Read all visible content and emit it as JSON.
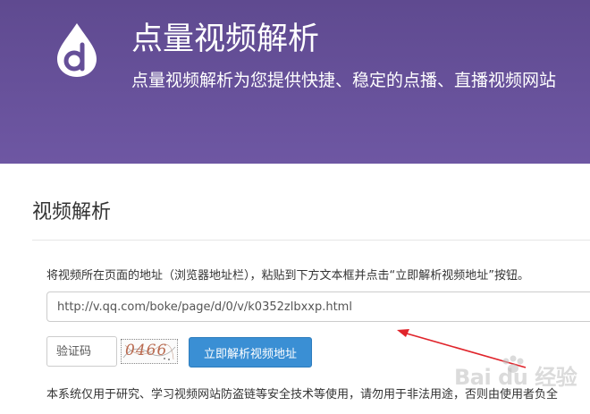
{
  "header": {
    "title": "点量视频解析",
    "subtitle": "点量视频解析为您提供快捷、稳定的点播、直播视频网站",
    "logo_icon": "droplet-d-logo-icon"
  },
  "panel": {
    "title": "视频解析",
    "instruction": "将视频所在页面的地址（浏览器地址栏），粘贴到下方文本框并点击“立即解析视频地址”按钮。",
    "url_value": "http://v.qq.com/boke/page/d/0/v/k0352zlbxxp.html",
    "captcha_placeholder": "验证码",
    "captcha_image_text": "0466",
    "parse_button_label": "立即解析视频地址",
    "disclaimer": "本系统仅用于研究、学习视频网站防盗链等安全技术等使用，请勿用于非法用途，否则由使用者负全"
  },
  "watermark": {
    "text": "Bai du 经验"
  },
  "colors": {
    "header_bg": "#6a53a0",
    "button_bg": "#3a8fd4",
    "annotation_arrow": "#e0242b"
  }
}
